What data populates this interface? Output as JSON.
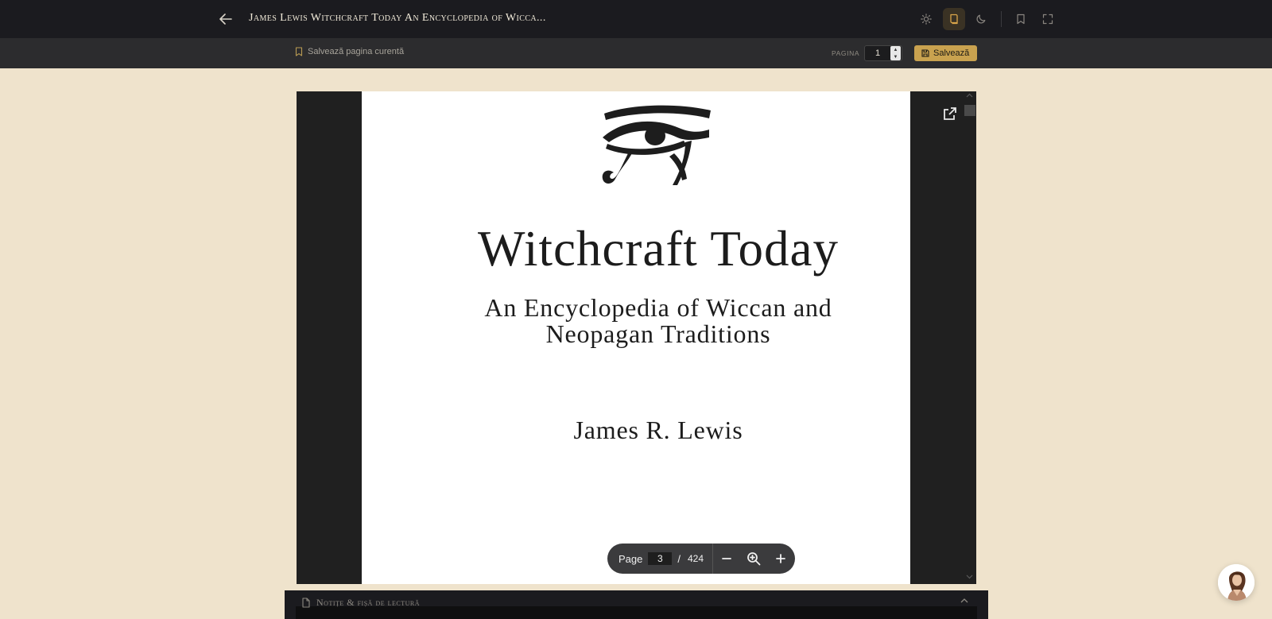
{
  "header": {
    "title": "James Lewis Witchcraft Today An Encyclopedia of Wicca...",
    "icons": [
      "back-arrow-icon",
      "sun-icon",
      "book-mode-icon",
      "moon-icon",
      "bookmark-icon",
      "fullscreen-icon"
    ],
    "active_icon": "book-mode-icon",
    "accent_color": "#c9a24f"
  },
  "subbar": {
    "save_current_label": "Salvează pagina curentă",
    "page_label": "PAGINA",
    "page_value": "1",
    "save_button_label": "Salvează"
  },
  "pdf": {
    "title": "Witchcraft Today",
    "subtitle_line1": "An Encyclopedia of Wiccan and",
    "subtitle_line2": "Neopagan Traditions",
    "author": "James R. Lewis",
    "toolbar": {
      "page_label": "Page",
      "current_page": "3",
      "separator": "/",
      "total_pages": "424"
    }
  },
  "notes": {
    "label": "Notițe & fișă de lectură"
  }
}
